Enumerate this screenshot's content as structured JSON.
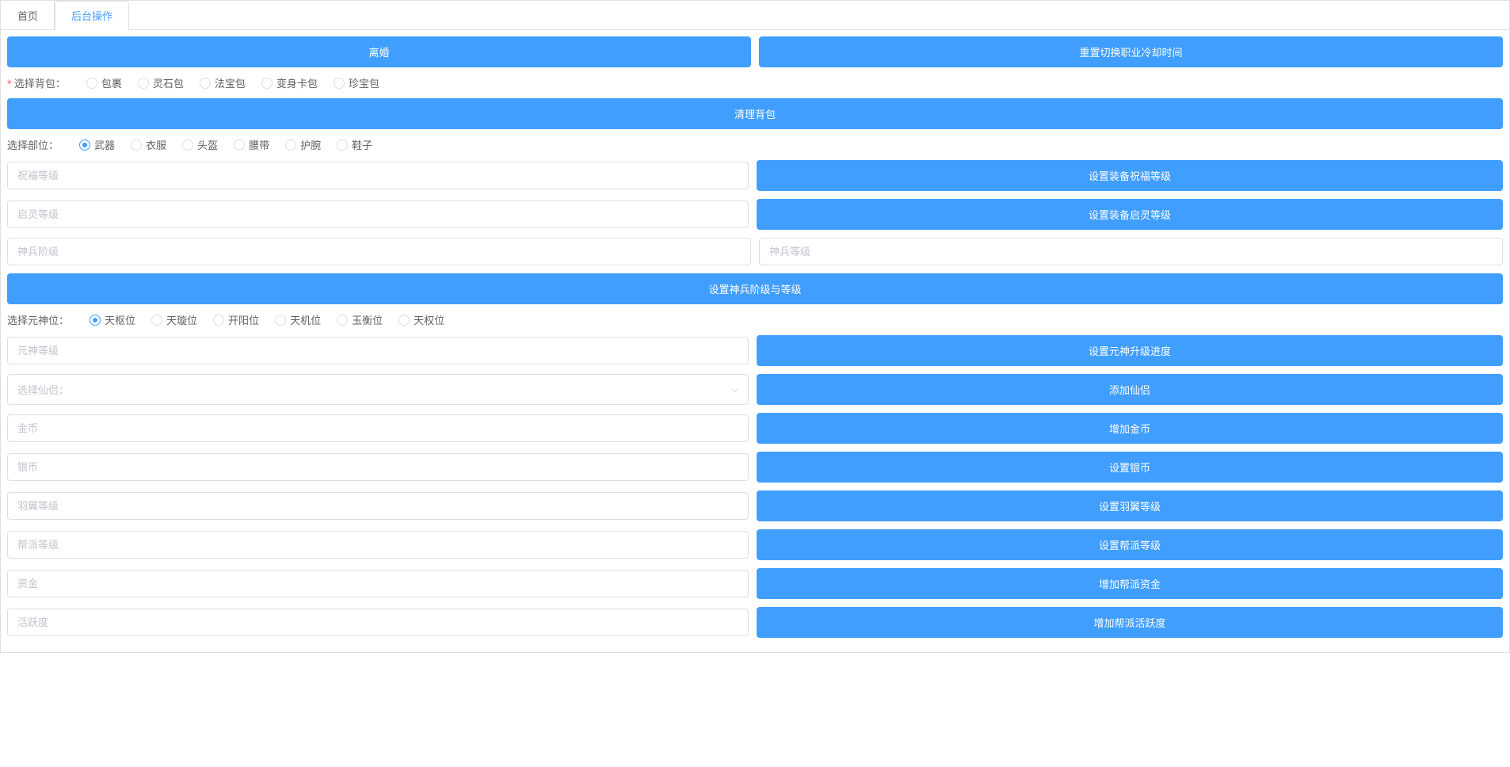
{
  "tabs": {
    "home": "首页",
    "backend": "后台操作"
  },
  "buttons": {
    "divorce": "离婚",
    "reset_job_cd": "重置切换职业冷却时间",
    "clear_bag": "清理背包",
    "set_equip_bless": "设置装备祝福等级",
    "set_equip_qiling": "设置装备启灵等级",
    "set_shenbing": "设置神兵阶级与等级",
    "set_yuanshen": "设置元神升级进度",
    "add_xianlv": "添加仙侣",
    "add_gold": "增加金币",
    "set_silver": "设置银币",
    "set_wing": "设置羽翼等级",
    "set_guild": "设置帮派等级",
    "add_guild_fund": "增加帮派资金",
    "add_guild_activity": "增加帮派活跃度"
  },
  "labels": {
    "select_bag": "选择背包：",
    "select_part": "选择部位：",
    "select_yuanshen": "选择元神位："
  },
  "radios": {
    "bag": [
      "包裹",
      "灵石包",
      "法宝包",
      "变身卡包",
      "珍宝包"
    ],
    "part": [
      "武器",
      "衣服",
      "头盔",
      "腰带",
      "护腕",
      "鞋子"
    ],
    "yuanshen": [
      "天枢位",
      "天璇位",
      "开阳位",
      "天机位",
      "玉衡位",
      "天权位"
    ]
  },
  "placeholders": {
    "bless_level": "祝福等级",
    "qiling_level": "启灵等级",
    "shenbing_stage": "神兵阶级",
    "shenbing_level": "神兵等级",
    "yuanshen_level": "元神等级",
    "select_xianlv": "选择仙侣：",
    "gold": "金币",
    "silver": "银币",
    "wing_level": "羽翼等级",
    "guild_level": "帮派等级",
    "fund": "资金",
    "activity": "活跃度"
  }
}
